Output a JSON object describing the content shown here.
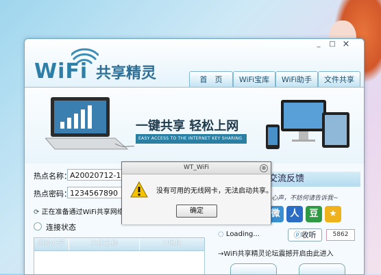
{
  "window": {
    "controls": {
      "minimize": "_",
      "maximize": "□",
      "close": "×"
    }
  },
  "logo": {
    "wifi": "WiFi",
    "cn": "共享精灵"
  },
  "nav": {
    "tabs": [
      {
        "label": "首　页"
      },
      {
        "label": "WiFi宝库"
      },
      {
        "label": "WiFi助手"
      },
      {
        "label": "文件共享"
      }
    ]
  },
  "banner": {
    "slogan": "一键共享 轻松上网",
    "slogan_en": "EASY ACCESS TO THE INTERNET KEY SHARING"
  },
  "form": {
    "hotspot_name_label": "热点名称：",
    "hotspot_name_value": "A20020712-12",
    "hotspot_password_label": "热点密码：",
    "hotspot_password_value": "1234567890",
    "status": "正在准备通过WiFi共享网络",
    "connection_state": "连接状态"
  },
  "table": {
    "columns": [
      "网络共享",
      "主机名称",
      "IP地址"
    ]
  },
  "right_panel": {
    "header": "交流反馈",
    "note": "心声，不妨何请告诉我~",
    "socials": [
      {
        "icon": "weibo-icon",
        "glyph": "微",
        "color": "#3a8fd1"
      },
      {
        "icon": "renren-icon",
        "glyph": "人",
        "color": "#2b6cc4"
      },
      {
        "icon": "douban-icon",
        "glyph": "豆",
        "color": "#2f9a43"
      },
      {
        "icon": "star-icon",
        "glyph": "★",
        "color": "#f0b21a"
      }
    ],
    "listen_label": "收听",
    "listen_count": "5862",
    "loading": "Loading...",
    "forum_link": "→WiFi共享精灵论坛震撼开启由此进入"
  },
  "dialog": {
    "title": "WT_WiFi",
    "message": "没有可用的无线网卡，无法启动共享。",
    "ok_label": "确定",
    "close_glyph": "⊗"
  }
}
